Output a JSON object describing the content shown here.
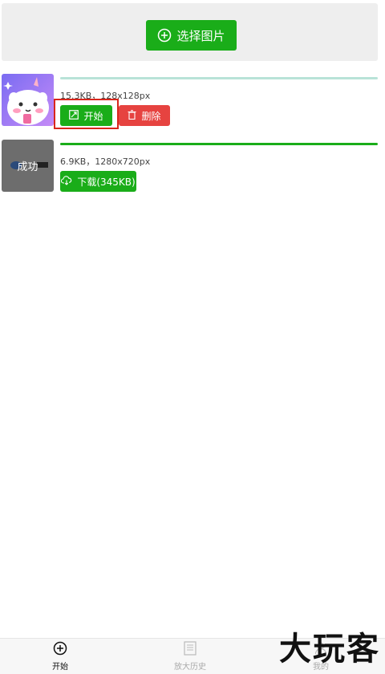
{
  "upload": {
    "select_label": "选择图片"
  },
  "items": [
    {
      "meta": "15.3KB，128x128px",
      "progress_color": "#b9e3d8",
      "start_label": "开始",
      "delete_label": "删除"
    },
    {
      "meta": "6.9KB，1280x720px",
      "progress_color": "#1aad19",
      "overlay_text": "成功",
      "download_label": "下载(345KB)"
    }
  ],
  "tabbar": {
    "tabs": [
      {
        "label": "开始",
        "icon": "plus-circle-icon",
        "active": true
      },
      {
        "label": "放大历史",
        "icon": "document-icon",
        "active": false
      },
      {
        "label": "我的",
        "icon": "user-icon",
        "active": false
      }
    ]
  },
  "watermark": "大玩客",
  "colors": {
    "primary": "#1aad19",
    "danger": "#e64340",
    "highlight": "#d9261c"
  }
}
